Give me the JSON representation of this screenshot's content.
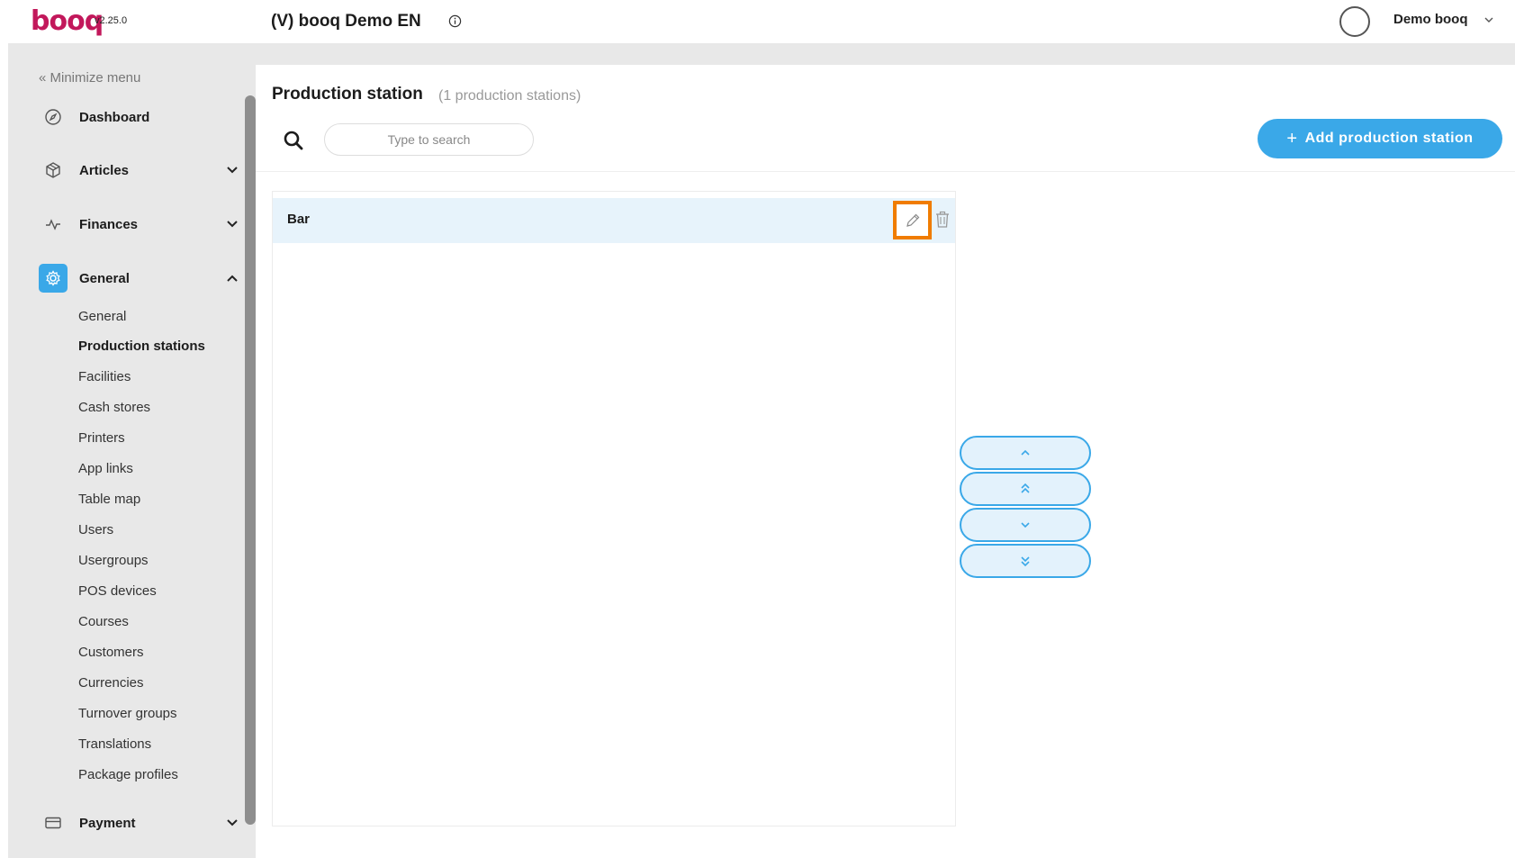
{
  "header": {
    "logo_text": "booq",
    "version": "v2.25.0",
    "env_title": "(V) booq Demo EN",
    "user_name": "Demo booq"
  },
  "sidebar": {
    "minimize_label": "« Minimize menu",
    "items": [
      {
        "label": "Dashboard",
        "icon": "compass-icon"
      },
      {
        "label": "Articles",
        "icon": "cube-icon"
      },
      {
        "label": "Finances",
        "icon": "pulse-icon"
      },
      {
        "label": "General",
        "icon": "gear-icon"
      },
      {
        "label": "Payment",
        "icon": "card-icon"
      }
    ],
    "general_sub": [
      {
        "label": "General"
      },
      {
        "label": "Production stations"
      },
      {
        "label": "Facilities"
      },
      {
        "label": "Cash stores"
      },
      {
        "label": "Printers"
      },
      {
        "label": "App links"
      },
      {
        "label": "Table map"
      },
      {
        "label": "Users"
      },
      {
        "label": "Usergroups"
      },
      {
        "label": "POS devices"
      },
      {
        "label": "Courses"
      },
      {
        "label": "Customers"
      },
      {
        "label": "Currencies"
      },
      {
        "label": "Turnover groups"
      },
      {
        "label": "Translations"
      },
      {
        "label": "Package profiles"
      }
    ],
    "active_sub": "Production stations"
  },
  "main": {
    "title": "Production station",
    "count_label": "(1 production stations)",
    "search_placeholder": "Type to search",
    "add_button_label": "Add production station",
    "rows": [
      {
        "label": "Bar"
      }
    ],
    "move_buttons": [
      "move-up",
      "move-to-top",
      "move-down",
      "move-to-bottom"
    ]
  },
  "colors": {
    "accent": "#3aa8e8",
    "highlight": "#f07c00",
    "logo": "#c2185b",
    "row_selected": "#e7f3fb"
  }
}
